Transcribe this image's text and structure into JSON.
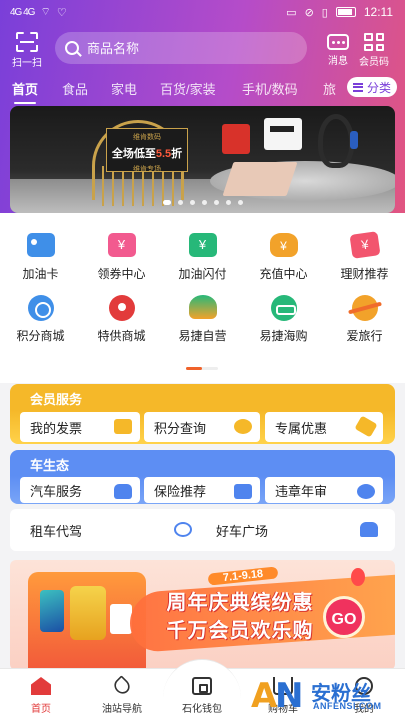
{
  "status_bar": {
    "network_left": "4G 4G",
    "time": "12:11"
  },
  "header": {
    "scan_label": "扫一扫",
    "search_placeholder": "商品名称",
    "message_label": "消息",
    "member_code_label": "会员码"
  },
  "tabs": [
    {
      "label": "首页",
      "active": true
    },
    {
      "label": "食品"
    },
    {
      "label": "家电"
    },
    {
      "label": "百货/家装"
    },
    {
      "label": "手机/数码"
    },
    {
      "label": "旅"
    }
  ],
  "category_button": "分类",
  "banner": {
    "brand": "维肯数码",
    "headline_prefix": "全场低至",
    "headline_highlight": "5.5",
    "headline_suffix": "折",
    "tag": "维肯专场",
    "dots_count": 7,
    "active_dot": 0
  },
  "icon_grid": [
    {
      "label": "加油卡",
      "icon": "fuel-card-icon"
    },
    {
      "label": "领券中心",
      "icon": "coupon-center-icon"
    },
    {
      "label": "加油闪付",
      "icon": "flash-pay-icon"
    },
    {
      "label": "充值中心",
      "icon": "recharge-icon"
    },
    {
      "label": "理财推荐",
      "icon": "finance-icon"
    },
    {
      "label": "积分商城",
      "icon": "points-mall-icon"
    },
    {
      "label": "特供商城",
      "icon": "special-mall-icon"
    },
    {
      "label": "易捷自营",
      "icon": "self-operated-icon"
    },
    {
      "label": "易捷海购",
      "icon": "overseas-shopping-icon"
    },
    {
      "label": "爱旅行",
      "icon": "travel-icon"
    }
  ],
  "member_services": {
    "title": "会员服务",
    "items": [
      {
        "label": "我的发票",
        "icon": "invoice-icon"
      },
      {
        "label": "积分查询",
        "icon": "points-query-icon"
      },
      {
        "label": "专属优惠",
        "icon": "exclusive-offer-icon"
      }
    ]
  },
  "car_ecosystem": {
    "title": "车生态",
    "items": [
      {
        "label": "汽车服务",
        "icon": "car-service-icon"
      },
      {
        "label": "保险推荐",
        "icon": "insurance-icon"
      },
      {
        "label": "违章年审",
        "icon": "violation-icon"
      },
      {
        "label": "租车代驾",
        "icon": "steering-wheel-icon"
      },
      {
        "label": "好车广场",
        "icon": "car-plaza-icon"
      }
    ]
  },
  "promo": {
    "date_range": "7.1-9.18",
    "line1": "周年庆典缤纷惠",
    "line2": "千万会员欢乐购",
    "go_label": "GO"
  },
  "bottom_nav": [
    {
      "label": "首页",
      "icon": "home-icon",
      "active": true
    },
    {
      "label": "油站导航",
      "icon": "navigation-icon"
    },
    {
      "label": "石化钱包",
      "icon": "wallet-icon"
    },
    {
      "label": "购物车",
      "icon": "cart-icon"
    },
    {
      "label": "我的",
      "icon": "profile-icon"
    }
  ],
  "watermark": {
    "logo_letters": "AN",
    "cn": "安粉丝",
    "en": "ANFENSI.COM"
  },
  "colors": {
    "header_gradient_start": "#7a3fd9",
    "header_gradient_end": "#e2557f",
    "member_panel": "#f5b829",
    "car_panel": "#5d8ef3",
    "active_nav": "#e23b3b"
  }
}
